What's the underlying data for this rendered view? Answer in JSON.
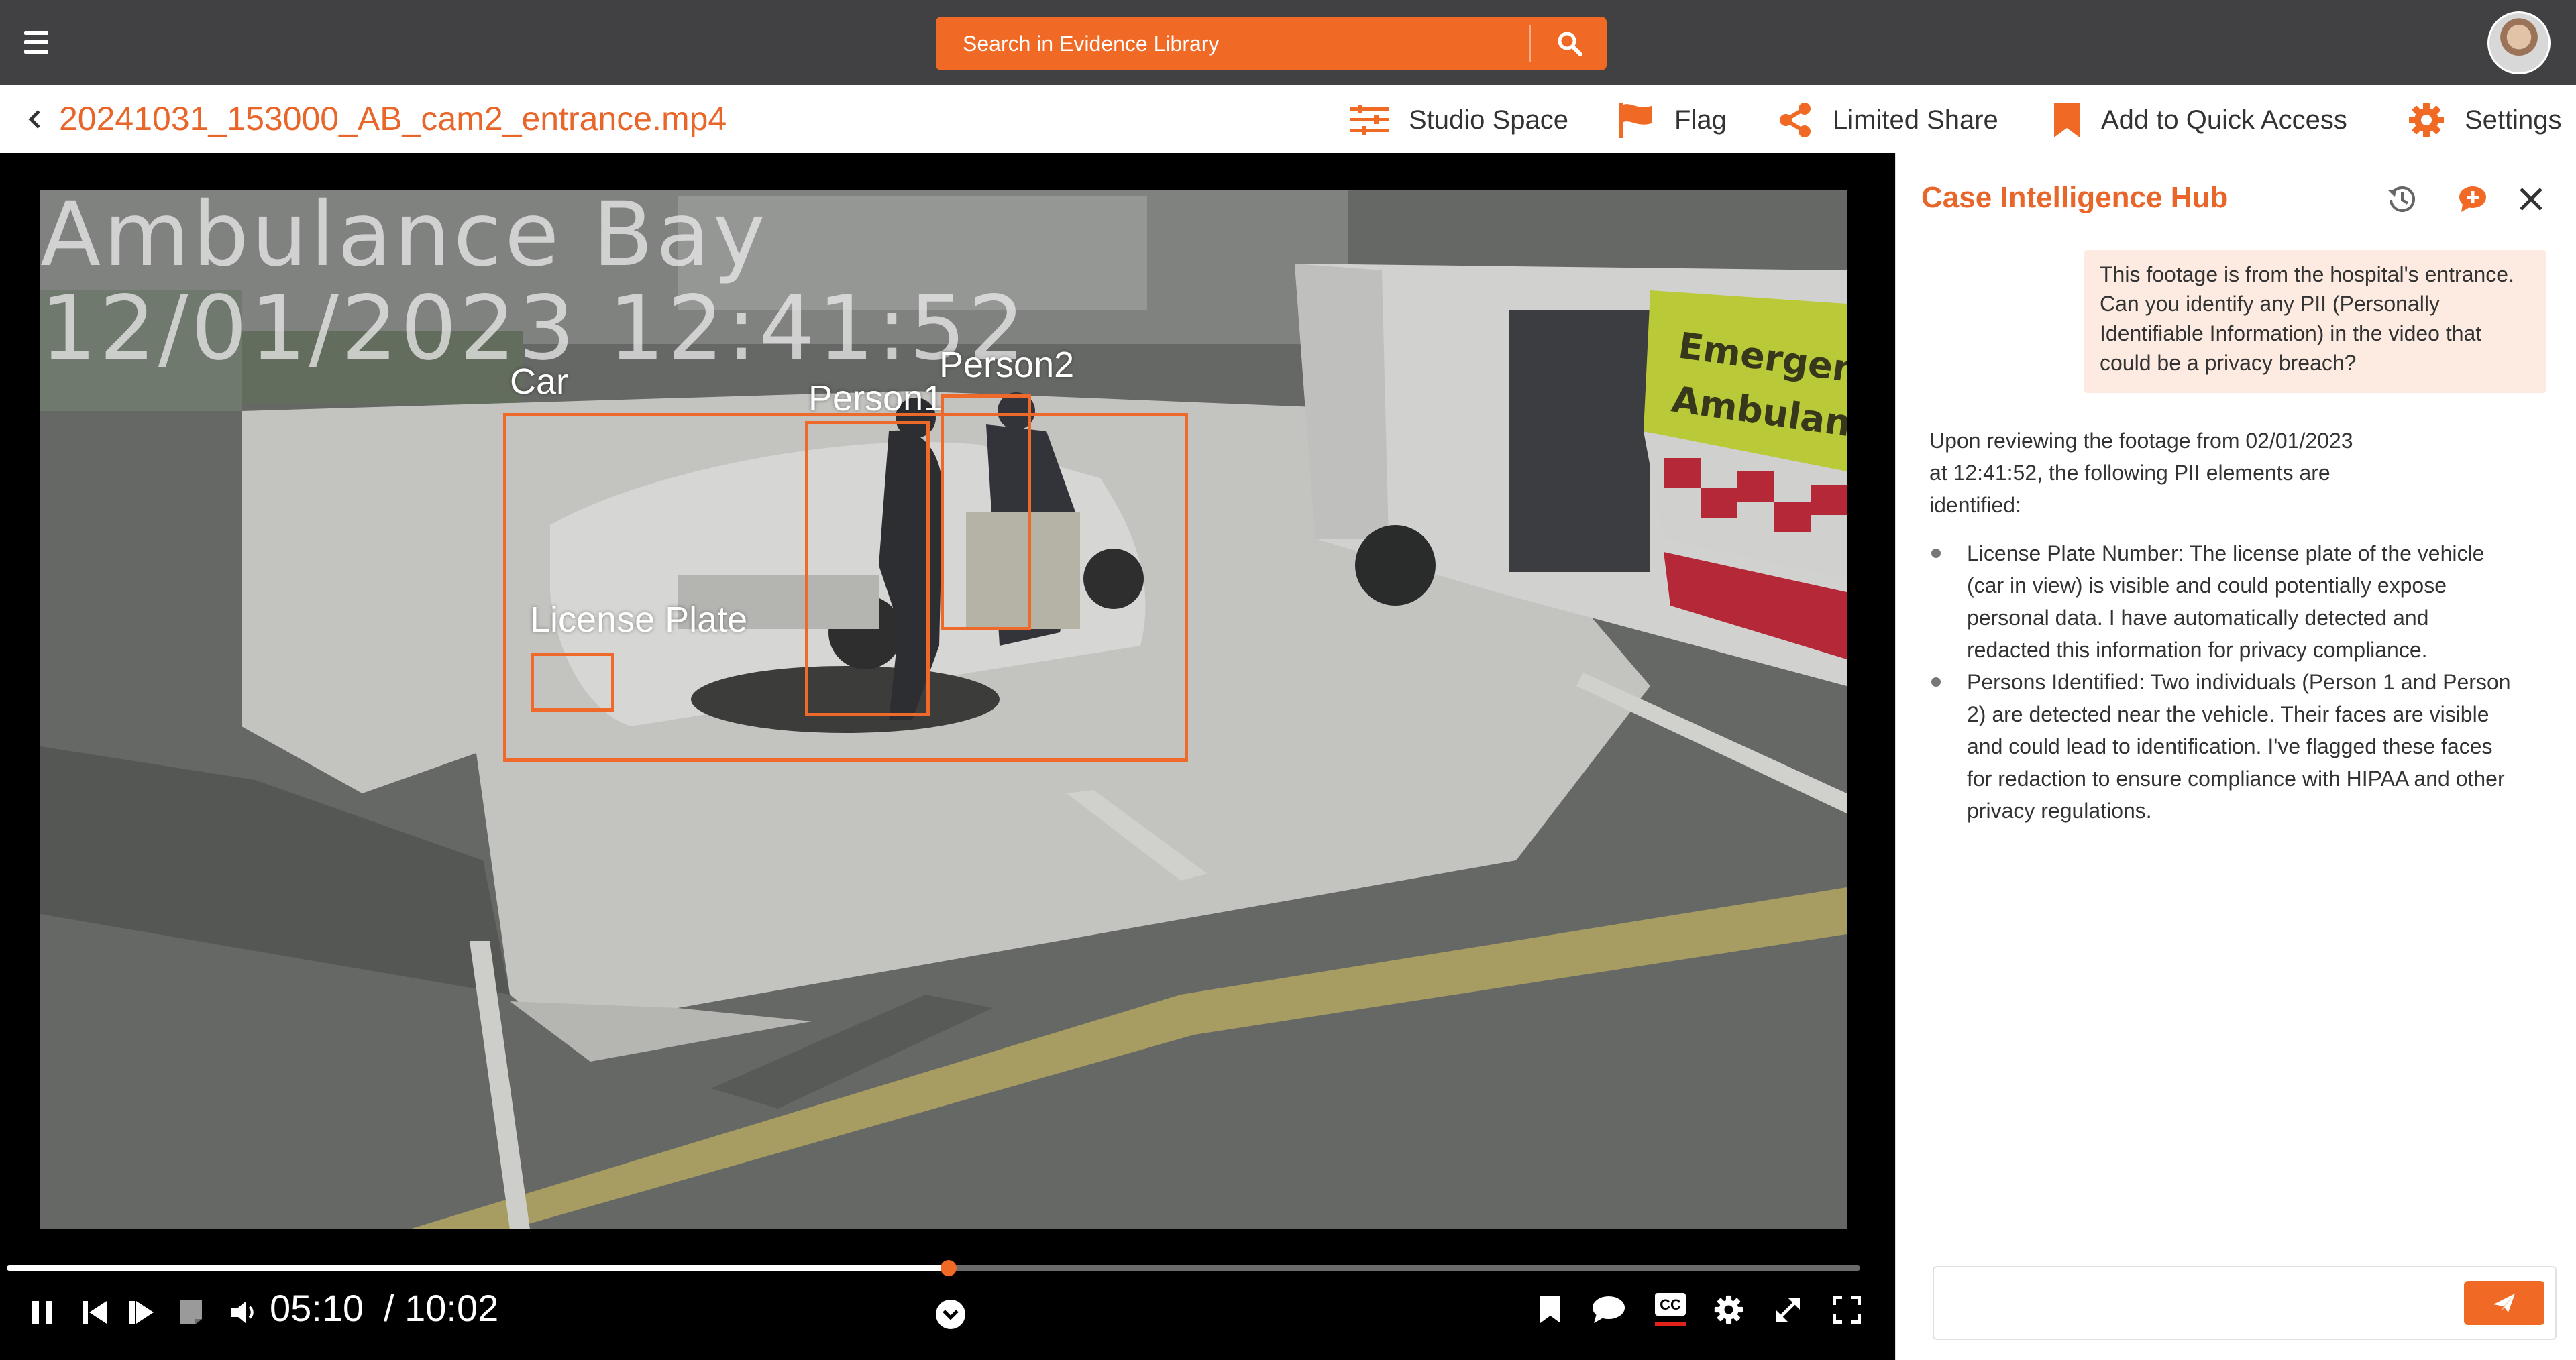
{
  "app": {
    "search_placeholder": "Search in Evidence Library"
  },
  "title": {
    "filename": "20241031_153000_AB_cam2_entrance.mp4"
  },
  "actions": [
    {
      "label": "Studio Space",
      "icon": "sliders-icon"
    },
    {
      "label": "Flag",
      "icon": "flag-icon"
    },
    {
      "label": "Limited Share",
      "icon": "share-icon"
    },
    {
      "label": "Add to Quick Access",
      "icon": "bookmark-icon"
    },
    {
      "label": "Settings",
      "icon": "gear-icon"
    }
  ],
  "video": {
    "osd_location": "Ambulance Bay",
    "osd_timestamp": "12/01/2023 12:41:52",
    "detections": [
      {
        "label": "Car"
      },
      {
        "label": "Person1"
      },
      {
        "label": "Person2"
      },
      {
        "label": "License Plate"
      }
    ],
    "scene_text": [
      "Emergency",
      "Ambulance"
    ]
  },
  "player": {
    "current_time": "05:10",
    "duration": "/ 10:02",
    "progress": 0.508
  },
  "panel": {
    "title": "Case Intelligence Hub",
    "user_message": "This footage is from the hospital's entrance. Can you identify any PII (Personally Identifiable Information) in the video that could be a privacy breach?",
    "ai_intro": "Upon reviewing the footage from 02/01/2023 at 12:41:52, the following PII elements are identified:",
    "ai_points": [
      "License Plate Number: The license plate of the vehicle (car in view) is visible and could potentially expose personal data. I have automatically detected and redacted this information for privacy compliance.",
      "Persons Identified: Two individuals (Person 1 and Person 2) are detected near the vehicle. Their faces are visible and could lead to identification. I've flagged these faces for redaction to ensure compliance with HIPAA and other privacy regulations."
    ],
    "input_placeholder": ""
  },
  "colors": {
    "accent": "#f06a26",
    "topbar": "#414143",
    "user_bubble": "#fdebe2"
  }
}
